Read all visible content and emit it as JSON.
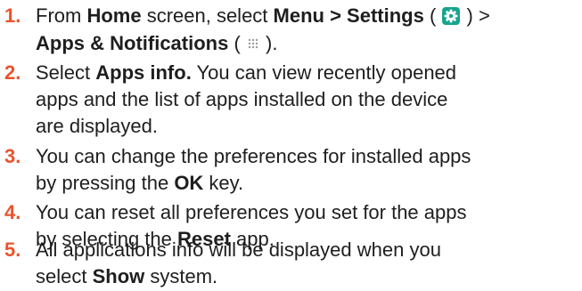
{
  "steps": [
    {
      "number": "1.",
      "line1": {
        "t1": "From ",
        "b1": "Home",
        "t2": " screen, select ",
        "b2": "Menu > Settings",
        "t3": " ( ",
        "t4": " ) >"
      },
      "line2": {
        "b1": "Apps & Notifications",
        "t1": " ( ",
        "t2": " )."
      },
      "icons": [
        "settings-gear-icon",
        "apps-grid-icon"
      ],
      "accent": "#e8542d",
      "settings_icon_bg": "#17a48f"
    },
    {
      "number": "2.",
      "line1": {
        "t1": "Select ",
        "b1": "Apps info.",
        "t2": " You can view recently opened"
      },
      "line2": "apps and the list of apps installed on the device",
      "line3": "are displayed."
    },
    {
      "number": "3.",
      "line1": "You can change the preferences for installed apps",
      "line2": {
        "t1": "by pressing the ",
        "b1": "OK",
        "t2": " key."
      }
    },
    {
      "number": "4.",
      "line1": "You can reset all preferences you set for the apps",
      "line2": {
        "t1": "by selecting the ",
        "b1": "Reset",
        "t2": " app."
      }
    },
    {
      "number": "5.",
      "line1": "All applications info will be displayed when you",
      "line2": {
        "t1": "select ",
        "b1": "Show",
        "t2": " system."
      }
    }
  ]
}
